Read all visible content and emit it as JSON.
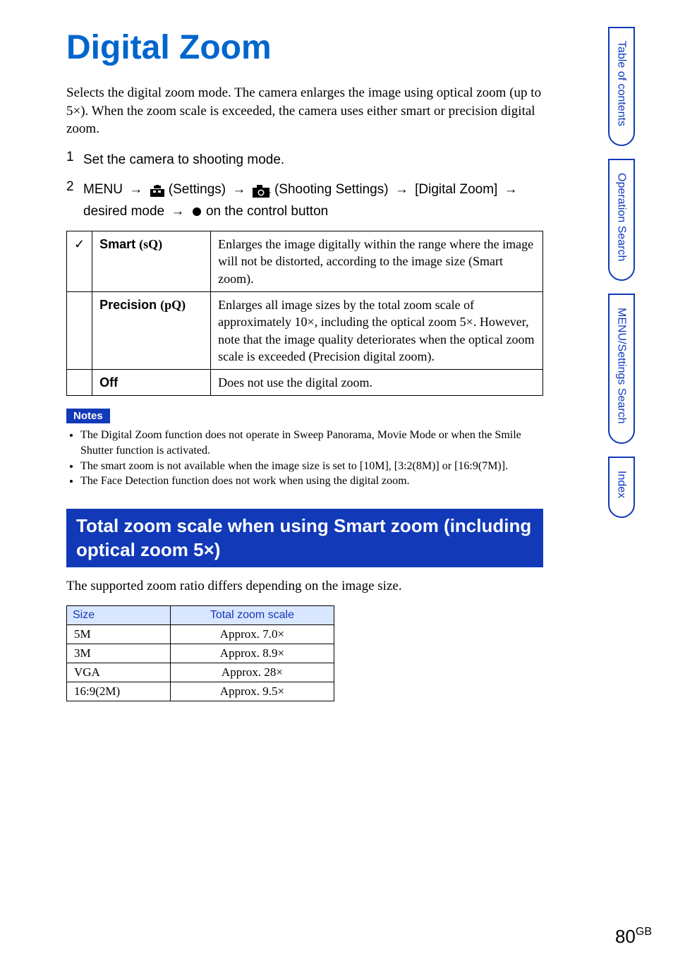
{
  "title": "Digital Zoom",
  "intro": "Selects the digital zoom mode. The camera enlarges the image using optical zoom (up to 5×). When the zoom scale is exceeded, the camera uses either smart or precision digital zoom.",
  "steps": {
    "s1": "Set the camera to shooting mode.",
    "s2_prefix": "MENU",
    "s2_settings": " (Settings)",
    "s2_shooting": " (Shooting Settings)",
    "s2_digitalzoom": "[Digital Zoom]",
    "s2_desired": "desired mode",
    "s2_control": " on the control button"
  },
  "options": [
    {
      "check": "✓",
      "name": "Smart",
      "icon": "(sQ)",
      "desc": "Enlarges the image digitally within the range where the image will not be distorted, according to the image size (Smart zoom)."
    },
    {
      "check": "",
      "name": "Precision",
      "icon": "(pQ)",
      "desc": "Enlarges all image sizes by the total zoom scale of approximately 10×, including the optical zoom 5×. However, note that the image quality deteriorates when the optical zoom scale is exceeded (Precision digital zoom)."
    },
    {
      "check": "",
      "name": "Off",
      "icon": "",
      "desc": "Does not use the digital zoom."
    }
  ],
  "notes_label": "Notes",
  "notes": [
    "The Digital Zoom function does not operate in Sweep Panorama, Movie Mode or when the Smile Shutter function is activated.",
    "The smart zoom is not available when the image size is set to [10M], [3:2(8M)] or [16:9(7M)].",
    "The Face Detection function does not work when using the digital zoom."
  ],
  "section2_title": "Total zoom scale when using Smart zoom (including optical zoom 5×)",
  "section2_intro": "The supported zoom ratio differs depending on the image size.",
  "zoom_table": {
    "h1": "Size",
    "h2": "Total zoom scale",
    "rows": [
      {
        "size": "5M",
        "scale": "Approx. 7.0×"
      },
      {
        "size": "3M",
        "scale": "Approx. 8.9×"
      },
      {
        "size": "VGA",
        "scale": "Approx. 28×"
      },
      {
        "size": "16:9(2M)",
        "scale": "Approx. 9.5×"
      }
    ]
  },
  "tabs": [
    "Table of contents",
    "Operation Search",
    "MENU/Settings Search",
    "Index"
  ],
  "page_number": "80",
  "page_suffix": "GB"
}
